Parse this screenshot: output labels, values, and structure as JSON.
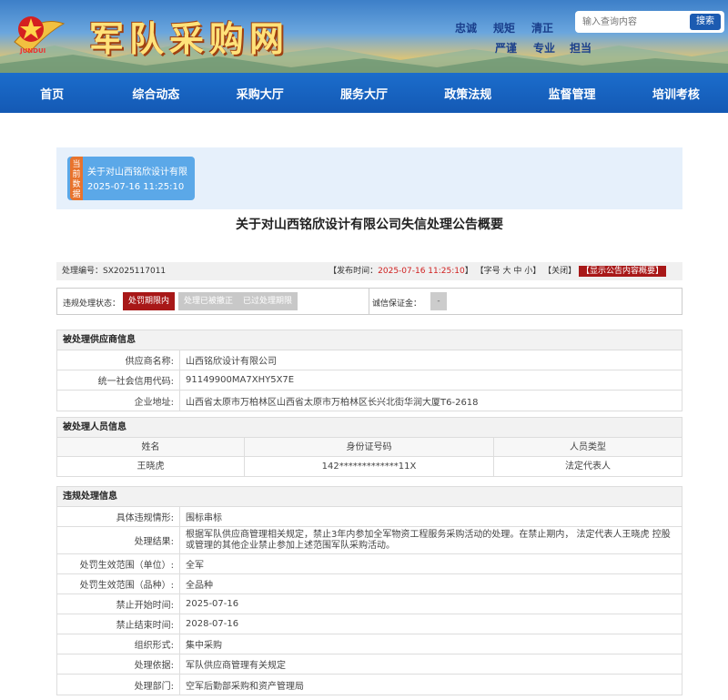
{
  "header": {
    "emblem_text": "JUNDUI",
    "site_title": "军队采购网",
    "slogans_row1": [
      "忠诚",
      "规矩",
      "清正"
    ],
    "slogans_row2": [
      "严谨",
      "专业",
      "担当"
    ],
    "search_placeholder": "输入查询内容",
    "search_button": "搜索"
  },
  "nav": [
    "首页",
    "综合动态",
    "采购大厅",
    "服务大厅",
    "政策法规",
    "监督管理",
    "培训考核"
  ],
  "banner": {
    "tag": "当前数据",
    "title": "关于对山西铭欣设计有限",
    "date": "2025-07-16 11:25:10"
  },
  "page_title": "关于对山西铭欣设计有限公司失信处理公告概要",
  "info_bar": {
    "case_no_label": "处理编号：",
    "case_no": "SX2025117011",
    "publish_label": "【发布时间：",
    "publish_time": "2025-07-16 11:25:10",
    "publish_close": "】",
    "font_size_text": "【字号 大 中 小】",
    "close_text": "【关闭】",
    "show_text": "【显示公告内容概要】"
  },
  "status": {
    "label": "违规处理状态：",
    "buttons": [
      "处罚期限内",
      "处理已被撤正",
      "已过处理期限"
    ],
    "deposit_label": "诚信保证金：",
    "deposit_value": "-"
  },
  "supplier": {
    "title": "被处理供应商信息",
    "rows": [
      {
        "label": "供应商名称:",
        "value": "山西铭欣设计有限公司"
      },
      {
        "label": "统一社会信用代码:",
        "value": "91149900MA7XHY5X7E"
      },
      {
        "label": "企业地址:",
        "value": "山西省太原市万柏林区山西省太原市万柏林区长兴北街华润大厦T6-2618"
      }
    ]
  },
  "person": {
    "title": "被处理人员信息",
    "headers": [
      "姓名",
      "身份证号码",
      "人员类型"
    ],
    "rows": [
      [
        "王晓虎",
        "142*************11X",
        "法定代表人"
      ]
    ]
  },
  "violation": {
    "title": "违规处理信息",
    "rows": [
      {
        "label": "具体违规情形:",
        "value": "围标串标"
      },
      {
        "label": "处理结果:",
        "value": "根据军队供应商管理相关规定，禁止3年内参加全军物资工程服务采购活动的处理。在禁止期内， 法定代表人王晓虎 控股或管理的其他企业禁止参加上述范围军队采购活动。"
      },
      {
        "label": "处罚生效范围（单位）:",
        "value": "全军"
      },
      {
        "label": "处罚生效范围（品种）:",
        "value": "全品种"
      },
      {
        "label": "禁止开始时间:",
        "value": "2025-07-16"
      },
      {
        "label": "禁止结束时间:",
        "value": "2028-07-16"
      },
      {
        "label": "组织形式:",
        "value": "集中采购"
      },
      {
        "label": "处理依据:",
        "value": "军队供应商管理有关规定"
      },
      {
        "label": "处理部门:",
        "value": "空军后勤部采购和资产管理局"
      }
    ]
  }
}
